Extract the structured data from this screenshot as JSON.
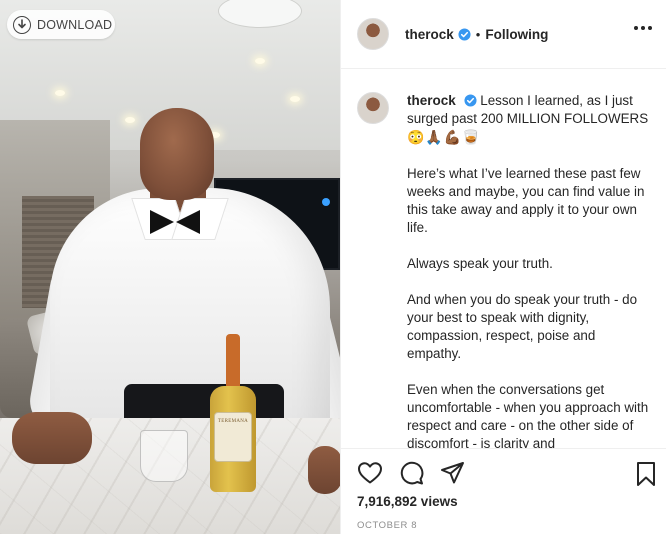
{
  "media": {
    "download_label": "DOWNLOAD",
    "bottle_label": "TEREMANA"
  },
  "post": {
    "username": "therock",
    "follow_status": "Following",
    "caption": {
      "line1": "Lesson I learned, as I just surged past 200 MILLION FOLLOWERS",
      "emojis": "😳🙏🏾💪🏾🥃",
      "p1": "Here’s what I’ve learned these past few weeks and maybe, you can find value in this take away and apply it to your own life.",
      "p2": "Always speak your truth.",
      "p3": "And when you do speak your truth - do your best to speak with dignity, compassion, respect, poise and empathy.",
      "p4": "Even when the conversations get uncomfortable - when you approach with respect and care - on the other side of discomfort - is clarity and"
    },
    "views": "7,916,892 views",
    "date": "OCTOBER 8"
  },
  "icons": {
    "download": "download-arrow-icon",
    "verified": "verified-badge-icon",
    "more": "more-options-icon",
    "like": "heart-icon",
    "comment": "comment-bubble-icon",
    "share": "paper-plane-icon",
    "save": "bookmark-icon"
  },
  "colors": {
    "verified_blue": "#3897f0",
    "text": "#262626",
    "muted": "#8e8e8e",
    "divider": "#efefef"
  }
}
